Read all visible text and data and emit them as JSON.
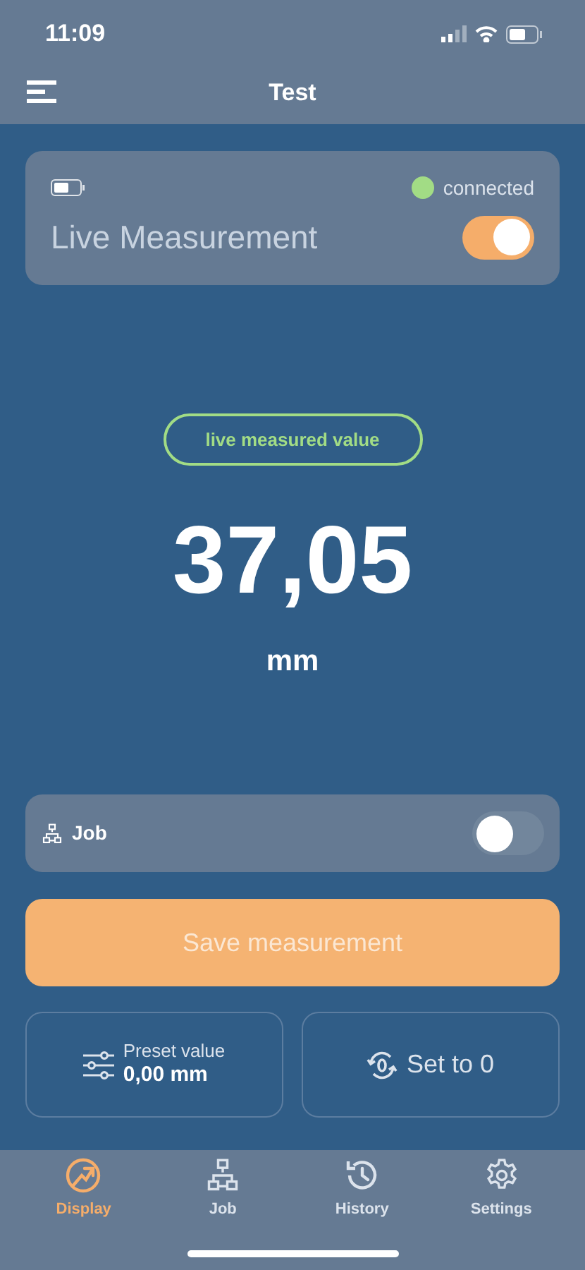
{
  "status_bar": {
    "time": "11:09"
  },
  "nav": {
    "title": "Test"
  },
  "device_card": {
    "connected": true,
    "connection": "connected",
    "live_label": "Live Measurement",
    "live_on": true
  },
  "measurement": {
    "badge": "live measured value",
    "value": "37,05",
    "unit": "mm"
  },
  "job_row": {
    "label": "Job",
    "on": false
  },
  "save_button": "Save measurement",
  "preset": {
    "label": "Preset value",
    "value": "0,00 mm"
  },
  "zero_button": "Set to 0",
  "tabs": [
    {
      "kind": "display",
      "label": "Display",
      "selected": true
    },
    {
      "kind": "job",
      "label": "Job",
      "selected": false
    },
    {
      "kind": "history",
      "label": "History",
      "selected": false
    },
    {
      "kind": "settings",
      "label": "Settings",
      "selected": false
    }
  ]
}
